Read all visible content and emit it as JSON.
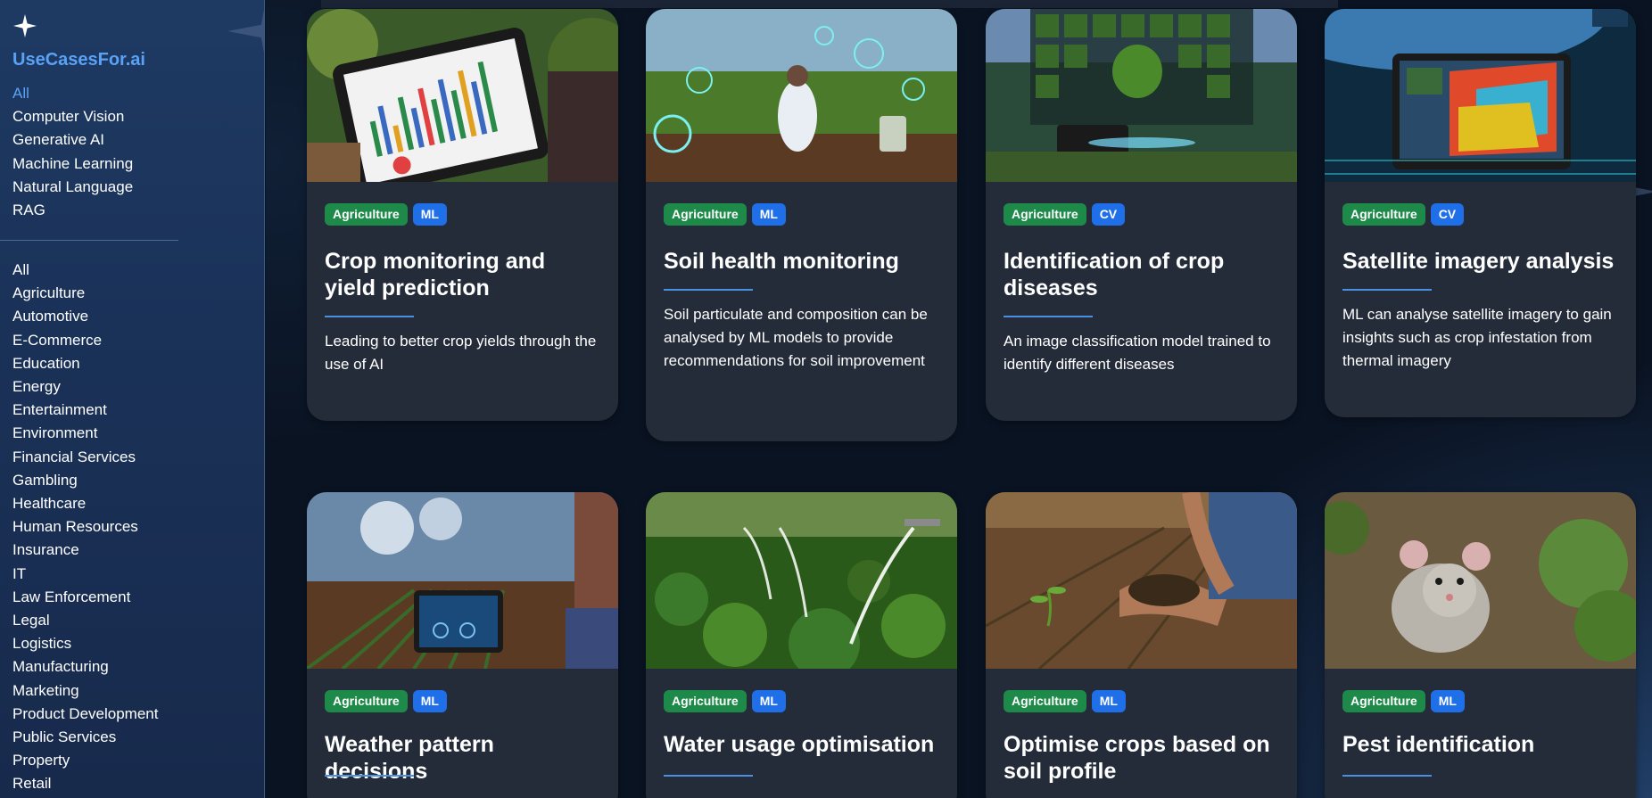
{
  "brand": "UseCasesFor.ai",
  "nav_tech": [
    "All",
    "Computer Vision",
    "Generative AI",
    "Machine Learning",
    "Natural Language",
    "RAG"
  ],
  "nav_industry": [
    "All",
    "Agriculture",
    "Automotive",
    "E-Commerce",
    "Education",
    "Energy",
    "Entertainment",
    "Environment",
    "Financial Services",
    "Gambling",
    "Healthcare",
    "Human Resources",
    "Insurance",
    "IT",
    "Law Enforcement",
    "Legal",
    "Logistics",
    "Manufacturing",
    "Marketing",
    "Product Development",
    "Public Services",
    "Property",
    "Retail"
  ],
  "cards": [
    {
      "industry": "Agriculture",
      "tech": "ML",
      "title": "Crop monitoring and yield prediction",
      "desc": "Leading to better crop yields through the use of AI"
    },
    {
      "industry": "Agriculture",
      "tech": "ML",
      "title": "Soil health monitoring",
      "desc": "Soil particulate and composition can be analysed by ML models to provide recommendations for soil improvement"
    },
    {
      "industry": "Agriculture",
      "tech": "CV",
      "title": "Identification of crop diseases",
      "desc": "An image classification model trained to identify different diseases"
    },
    {
      "industry": "Agriculture",
      "tech": "CV",
      "title": "Satellite imagery analysis",
      "desc": "ML can analyse satellite imagery to gain insights such as crop infestation from thermal imagery"
    },
    {
      "industry": "Agriculture",
      "tech": "ML",
      "title": "Weather pattern decisions",
      "desc": ""
    },
    {
      "industry": "Agriculture",
      "tech": "ML",
      "title": "Water usage optimisation",
      "desc": ""
    },
    {
      "industry": "Agriculture",
      "tech": "ML",
      "title": "Optimise crops based on soil profile",
      "desc": ""
    },
    {
      "industry": "Agriculture",
      "tech": "ML",
      "title": "Pest identification",
      "desc": ""
    }
  ],
  "colors": {
    "accent": "#5aa2f5",
    "industry_tag": "#1e8a4a",
    "tech_tag": "#1f6fe8",
    "card_bg": "#242c3a"
  }
}
